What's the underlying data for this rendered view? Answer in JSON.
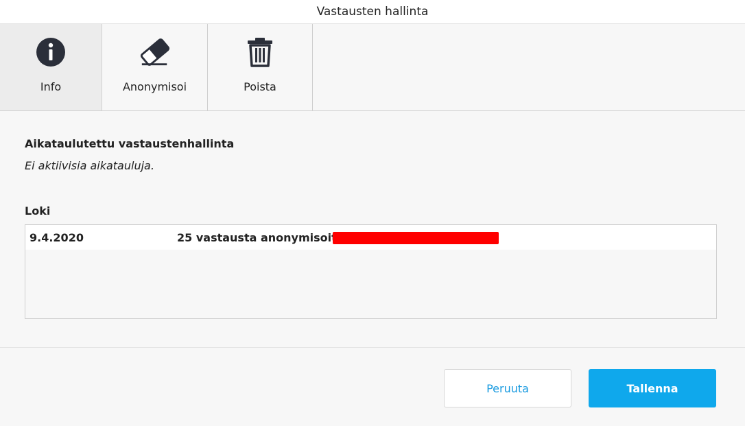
{
  "window": {
    "title": "Vastausten hallinta"
  },
  "toolbar": {
    "items": [
      {
        "label": "Info",
        "icon": "info-icon",
        "active": true
      },
      {
        "label": "Anonymisoi",
        "icon": "eraser-icon",
        "active": false
      },
      {
        "label": "Poista",
        "icon": "trash-icon",
        "active": false
      }
    ]
  },
  "schedule": {
    "title": "Aikataulutettu vastaustenhallinta",
    "empty_text": "Ei aktiivisia aikatauluja."
  },
  "log": {
    "title": "Loki",
    "entries": [
      {
        "date": "9.4.2020",
        "message": "25 vastausta anonymisoitu",
        "redacted": true
      }
    ]
  },
  "footer": {
    "cancel_label": "Peruuta",
    "save_label": "Tallenna"
  },
  "colors": {
    "accent": "#0fa8ec",
    "link": "#1a9be0",
    "redaction": "#ff0000"
  }
}
